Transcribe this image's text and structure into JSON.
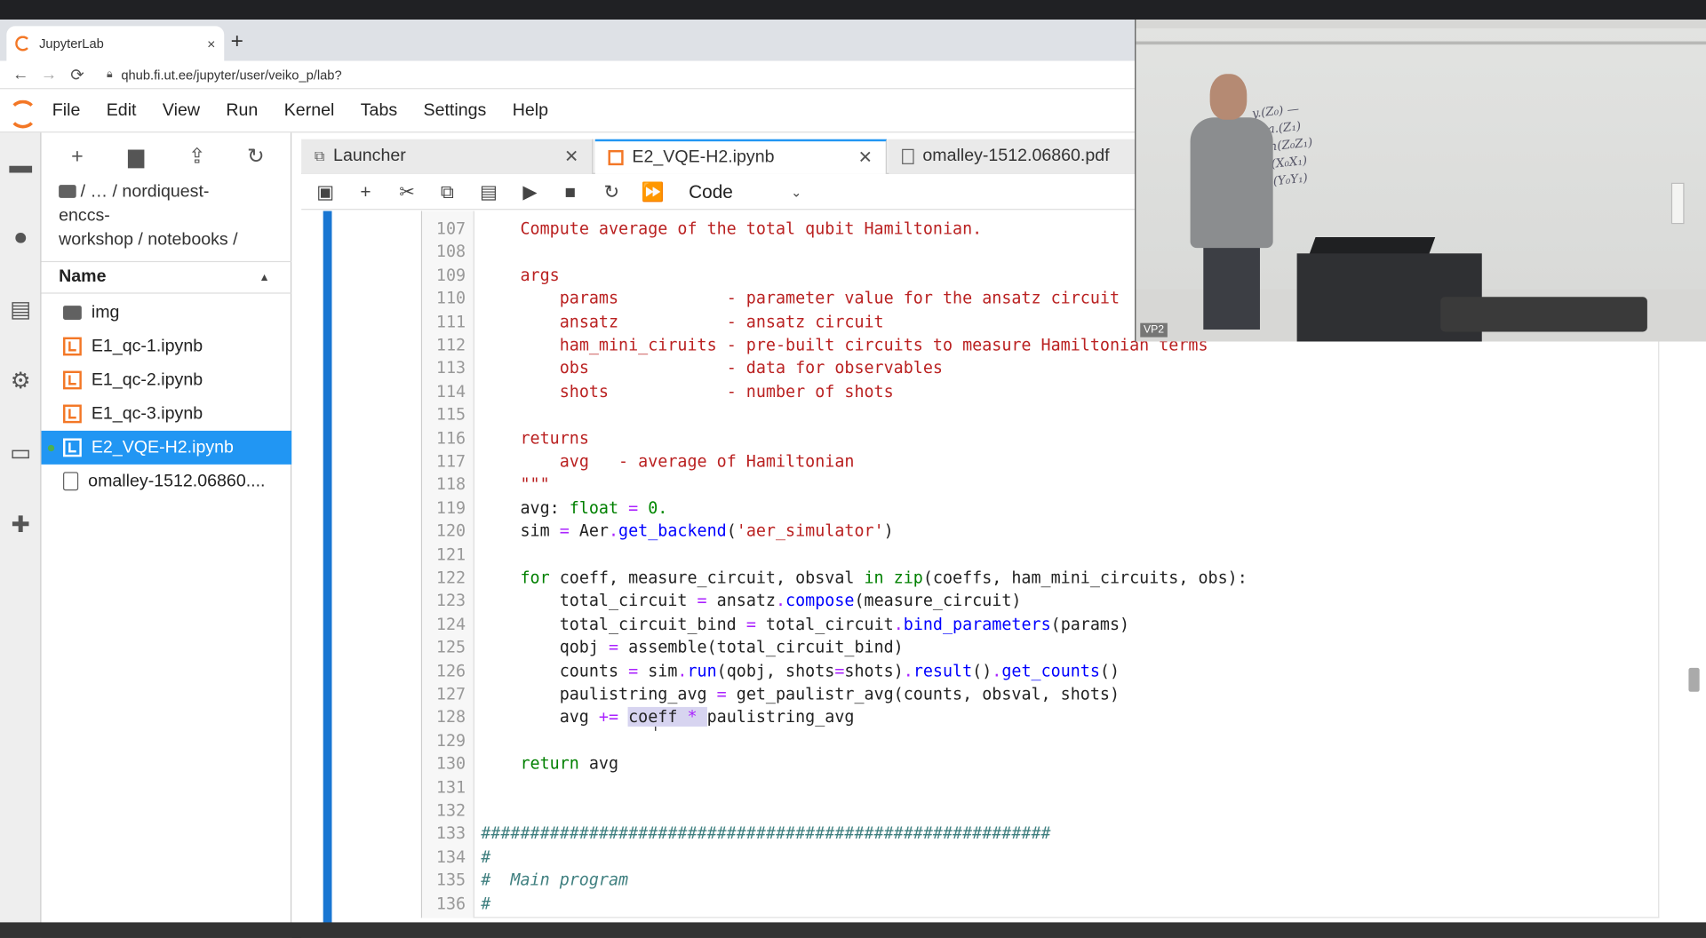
{
  "browser": {
    "tab_title": "JupyterLab",
    "tab_close": "×",
    "new_tab": "+",
    "back": "←",
    "forward": "→",
    "reload": "C",
    "url": "qhub.fi.ut.ee/jupyter/user/veiko_p/lab?"
  },
  "menu": [
    "File",
    "Edit",
    "View",
    "Run",
    "Kernel",
    "Tabs",
    "Settings",
    "Help"
  ],
  "filebrowser": {
    "breadcrumb_line1": "/ … / nordiquest-",
    "breadcrumb_line2": "enccs-",
    "breadcrumb_line3": "workshop / notebooks /",
    "header": "Name",
    "files": [
      {
        "name": "img",
        "type": "folder"
      },
      {
        "name": "E1_qc-1.ipynb",
        "type": "notebook"
      },
      {
        "name": "E1_qc-2.ipynb",
        "type": "notebook"
      },
      {
        "name": "E1_qc-3.ipynb",
        "type": "notebook"
      },
      {
        "name": "E2_VQE-H2.ipynb",
        "type": "notebook"
      },
      {
        "name": "omalley-1512.06860....",
        "type": "pdf"
      }
    ]
  },
  "tabs": [
    {
      "label": "Launcher"
    },
    {
      "label": "E2_VQE-H2.ipynb"
    },
    {
      "label": "omalley-1512.06860.pdf"
    }
  ],
  "toolbar": {
    "cell_type": "Code"
  },
  "code_lines": [
    {
      "n": "107",
      "html": "    <span class=\"str\">Compute average of the total qubit Hamiltonian.</span>"
    },
    {
      "n": "108",
      "html": ""
    },
    {
      "n": "109",
      "html": "    <span class=\"str\">args</span>"
    },
    {
      "n": "110",
      "html": "        <span class=\"str\">params           - parameter value for the ansatz circuit</span>"
    },
    {
      "n": "111",
      "html": "        <span class=\"str\">ansatz           - ansatz circuit</span>"
    },
    {
      "n": "112",
      "html": "        <span class=\"str\">ham_mini_ciruits - pre-built circuits to measure Hamiltonian terms</span>"
    },
    {
      "n": "113",
      "html": "        <span class=\"str\">obs              - data for observables</span>"
    },
    {
      "n": "114",
      "html": "        <span class=\"str\">shots            - number of shots</span>"
    },
    {
      "n": "115",
      "html": ""
    },
    {
      "n": "116",
      "html": "    <span class=\"str\">returns</span>"
    },
    {
      "n": "117",
      "html": "        <span class=\"str\">avg   - average of Hamiltonian</span>"
    },
    {
      "n": "118",
      "html": "    <span class=\"str\">\"\"\"</span>"
    },
    {
      "n": "119",
      "html": "    avg: <span class=\"bi\">float</span> <span class=\"op\">=</span> <span class=\"num\">0.</span>"
    },
    {
      "n": "120",
      "html": "    sim <span class=\"op\">=</span> Aer<span class=\"op\">.</span><span class=\"fn\">get_backend</span>(<span class=\"str\">'aer_simulator'</span>)"
    },
    {
      "n": "121",
      "html": ""
    },
    {
      "n": "122",
      "html": "    <span class=\"kw\">for</span> coeff, measure_circuit, obsval <span class=\"kw\">in</span> <span class=\"bi\">zip</span>(coeffs, ham_mini_circuits, obs):"
    },
    {
      "n": "123",
      "html": "        total_circuit <span class=\"op\">=</span> ansatz<span class=\"op\">.</span><span class=\"fn\">compose</span>(measure_circuit)"
    },
    {
      "n": "124",
      "html": "        total_circuit_bind <span class=\"op\">=</span> total_circuit<span class=\"op\">.</span><span class=\"fn\">bind_parameters</span>(params)"
    },
    {
      "n": "125",
      "html": "        qobj <span class=\"op\">=</span> assemble(total_circuit_bind)"
    },
    {
      "n": "126",
      "html": "        counts <span class=\"op\">=</span> sim<span class=\"op\">.</span><span class=\"fn\">run</span>(qobj, shots<span class=\"op\">=</span>shots)<span class=\"op\">.</span><span class=\"fn\">result</span>()<span class=\"op\">.</span><span class=\"fn\">get_counts</span>()"
    },
    {
      "n": "127",
      "html": "        paulistring_avg <span class=\"op\">=</span> get_paulistr_avg(counts, obsval, shots)"
    },
    {
      "n": "128",
      "html": "        avg <span class=\"op\">+=</span> <span class=\"hl\">coeff <span class=\"op\">*</span> </span>paulistring_avg"
    },
    {
      "n": "129",
      "html": ""
    },
    {
      "n": "130",
      "html": "    <span class=\"kw\">return</span> avg"
    },
    {
      "n": "131",
      "html": ""
    },
    {
      "n": "132",
      "html": ""
    },
    {
      "n": "133",
      "html": "<span class=\"cmt\">##########################################################</span>"
    },
    {
      "n": "134",
      "html": "<span class=\"cmt\">#</span>"
    },
    {
      "n": "135",
      "html": "<span class=\"cmt\">#  Main program</span>"
    },
    {
      "n": "136",
      "html": "<span class=\"cmt\">#</span>"
    }
  ],
  "video": {
    "label": "VP2",
    "board_text": [
      "y.(Z₀)  —",
      "+ a.(Z₁)",
      "+ h(Z₀Z₁)",
      "+ (X₀X₁)",
      "+ (Y₀Y₁)"
    ]
  }
}
